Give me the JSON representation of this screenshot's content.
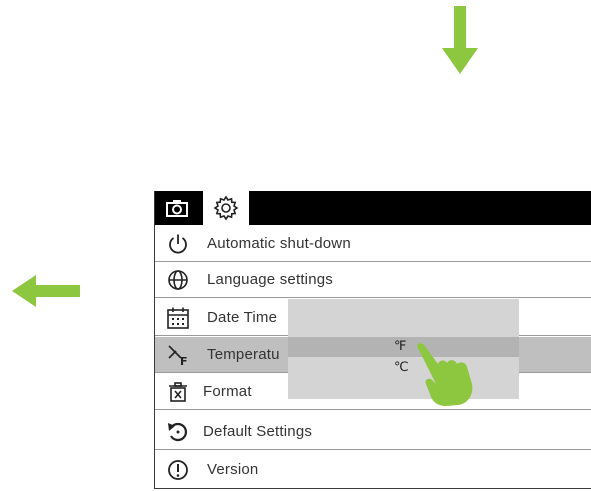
{
  "tabs": {
    "camera_icon": "camera-icon",
    "settings_icon": "gear-icon"
  },
  "menu": [
    {
      "label": "Automatic shut-down",
      "icon": "power-icon"
    },
    {
      "label": "Language settings",
      "icon": "globe-icon"
    },
    {
      "label": "Date Time",
      "icon": "calendar-icon"
    },
    {
      "label": "Temperatu",
      "icon": "temperature-unit-icon"
    },
    {
      "label": "Format",
      "icon": "trash-icon"
    },
    {
      "label": "Default Settings",
      "icon": "reset-icon"
    },
    {
      "label": "Version",
      "icon": "info-icon"
    }
  ],
  "popup": {
    "options": [
      "℉",
      "℃"
    ],
    "selected": "℉"
  },
  "colors": {
    "arrow": "#8dc63f",
    "tabbar": "#000000",
    "selected_row": "#bfbfbf",
    "popup": "#d4d4d4"
  }
}
